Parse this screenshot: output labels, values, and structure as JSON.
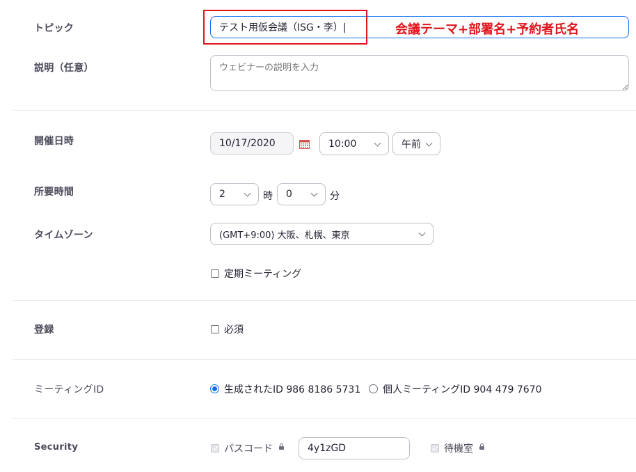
{
  "topic": {
    "label": "トピック",
    "value": "テスト用仮会議（ISG・李）|",
    "annotation": "会議テーマ+部署名+予約者氏名",
    "annotation_color": "#e0151c",
    "focus_color": "#0e72ed"
  },
  "description": {
    "label": "説明（任意）",
    "placeholder": "ウェビナーの説明を入力"
  },
  "schedule": {
    "label": "開催日時",
    "date": "10/17/2020",
    "time": "10:00",
    "ampm": "午前",
    "calendar_icon": "calendar-icon"
  },
  "duration": {
    "label": "所要時間",
    "hours": "2",
    "hours_unit": "時",
    "minutes": "0",
    "minutes_unit": "分"
  },
  "timezone": {
    "label": "タイムゾーン",
    "value": "(GMT+9:00) 大阪、札幌、東京"
  },
  "recurring": {
    "label": "定期ミーティング"
  },
  "registration": {
    "label": "登録",
    "required_label": "必須"
  },
  "meeting_id": {
    "label": "ミーティングID",
    "generated_label": "生成されたID 986 8186 5731",
    "personal_label": "個人ミーティングID 904 479 7670",
    "selected": "generated"
  },
  "security": {
    "label": "Security",
    "passcode_label": "パスコード",
    "passcode_value": "4y1zGD",
    "waiting_room_label": "待機室"
  }
}
